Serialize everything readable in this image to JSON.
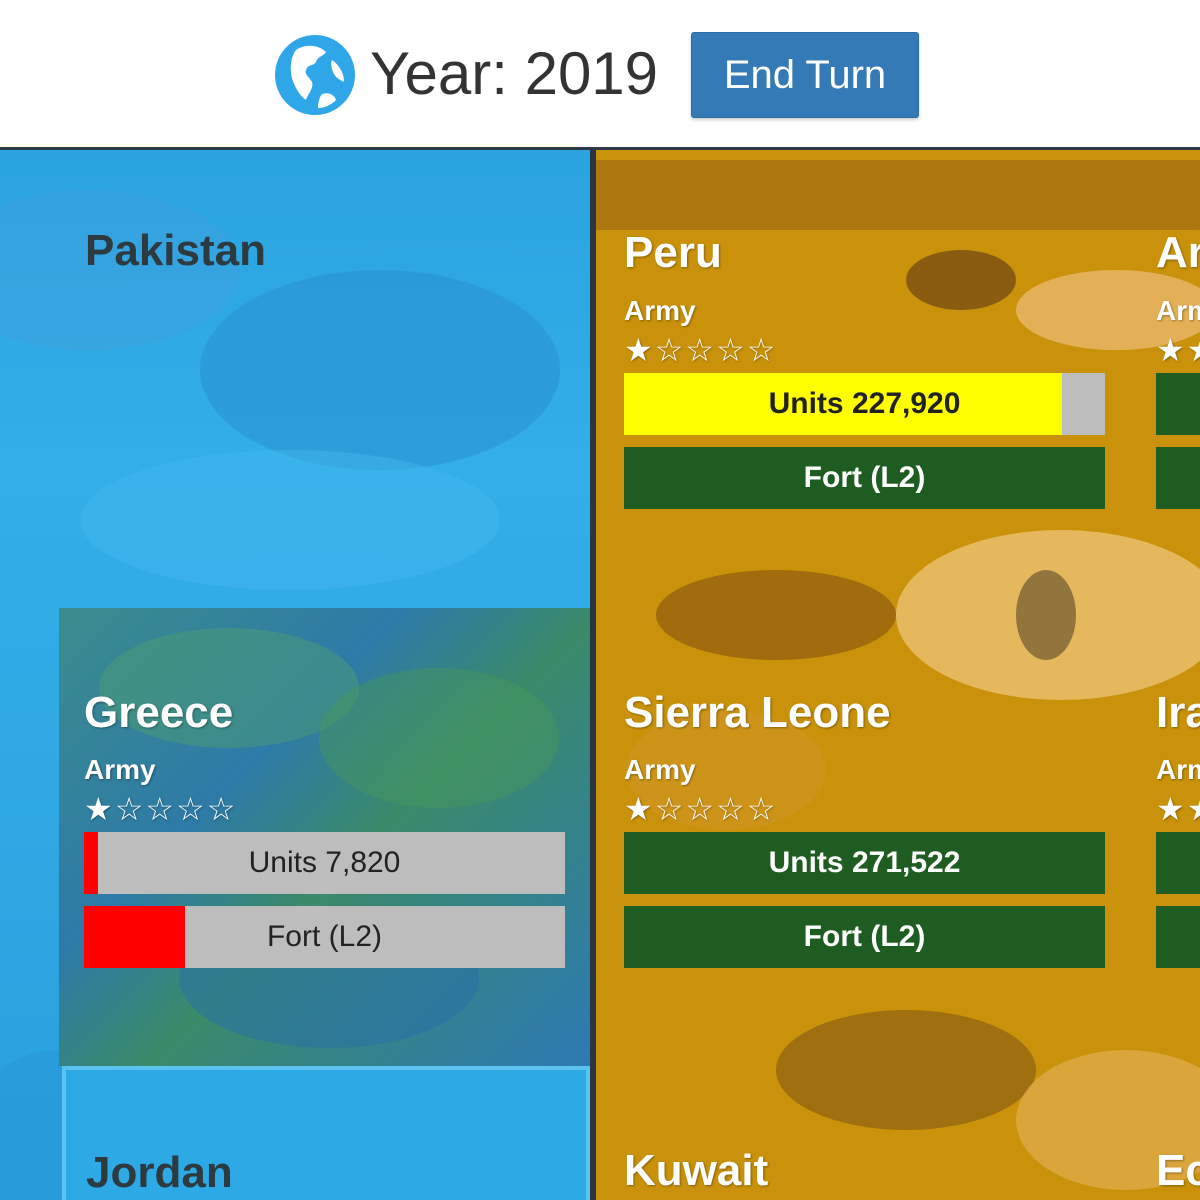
{
  "header": {
    "year_text": "Year: 2019",
    "end_turn_label": "End Turn"
  },
  "colors": {
    "ocean": "#2fa8e4",
    "enemy": "#c9920a",
    "strength_green": "#1e5c22",
    "warning_yellow": "#ffff00",
    "danger_red": "#ff0000",
    "button_blue": "#337ab7"
  },
  "left_territories": {
    "pakistan": {
      "name": "Pakistan"
    },
    "greece": {
      "name": "Greece",
      "army_label": "Army",
      "stars": "★☆☆☆☆",
      "star_rating": 1,
      "units_label": "Units 7,820",
      "units_fill_fraction": 0.03,
      "fort_label": "Fort (L2)",
      "fort_fill_fraction": 0.21
    },
    "jordan": {
      "name": "Jordan"
    }
  },
  "right_territories": {
    "peru": {
      "name": "Peru",
      "army_label": "Army",
      "stars": "★☆☆☆☆",
      "star_rating": 1,
      "units_label": "Units 227,920",
      "units_fill_fraction": 0.91,
      "fort_label": "Fort (L2)"
    },
    "sierra_leone": {
      "name": "Sierra Leone",
      "army_label": "Army",
      "stars": "★☆☆☆☆",
      "star_rating": 1,
      "units_label": "Units 271,522",
      "fort_label": "Fort (L2)"
    },
    "kuwait": {
      "name": "Kuwait"
    },
    "partial_top": {
      "name": "Ar",
      "army_label": "Arm",
      "stars": "★★"
    },
    "partial_mid": {
      "name": "Ira",
      "army_label": "Arm",
      "stars": "★★"
    },
    "partial_bottom": {
      "name": "Ec"
    }
  }
}
